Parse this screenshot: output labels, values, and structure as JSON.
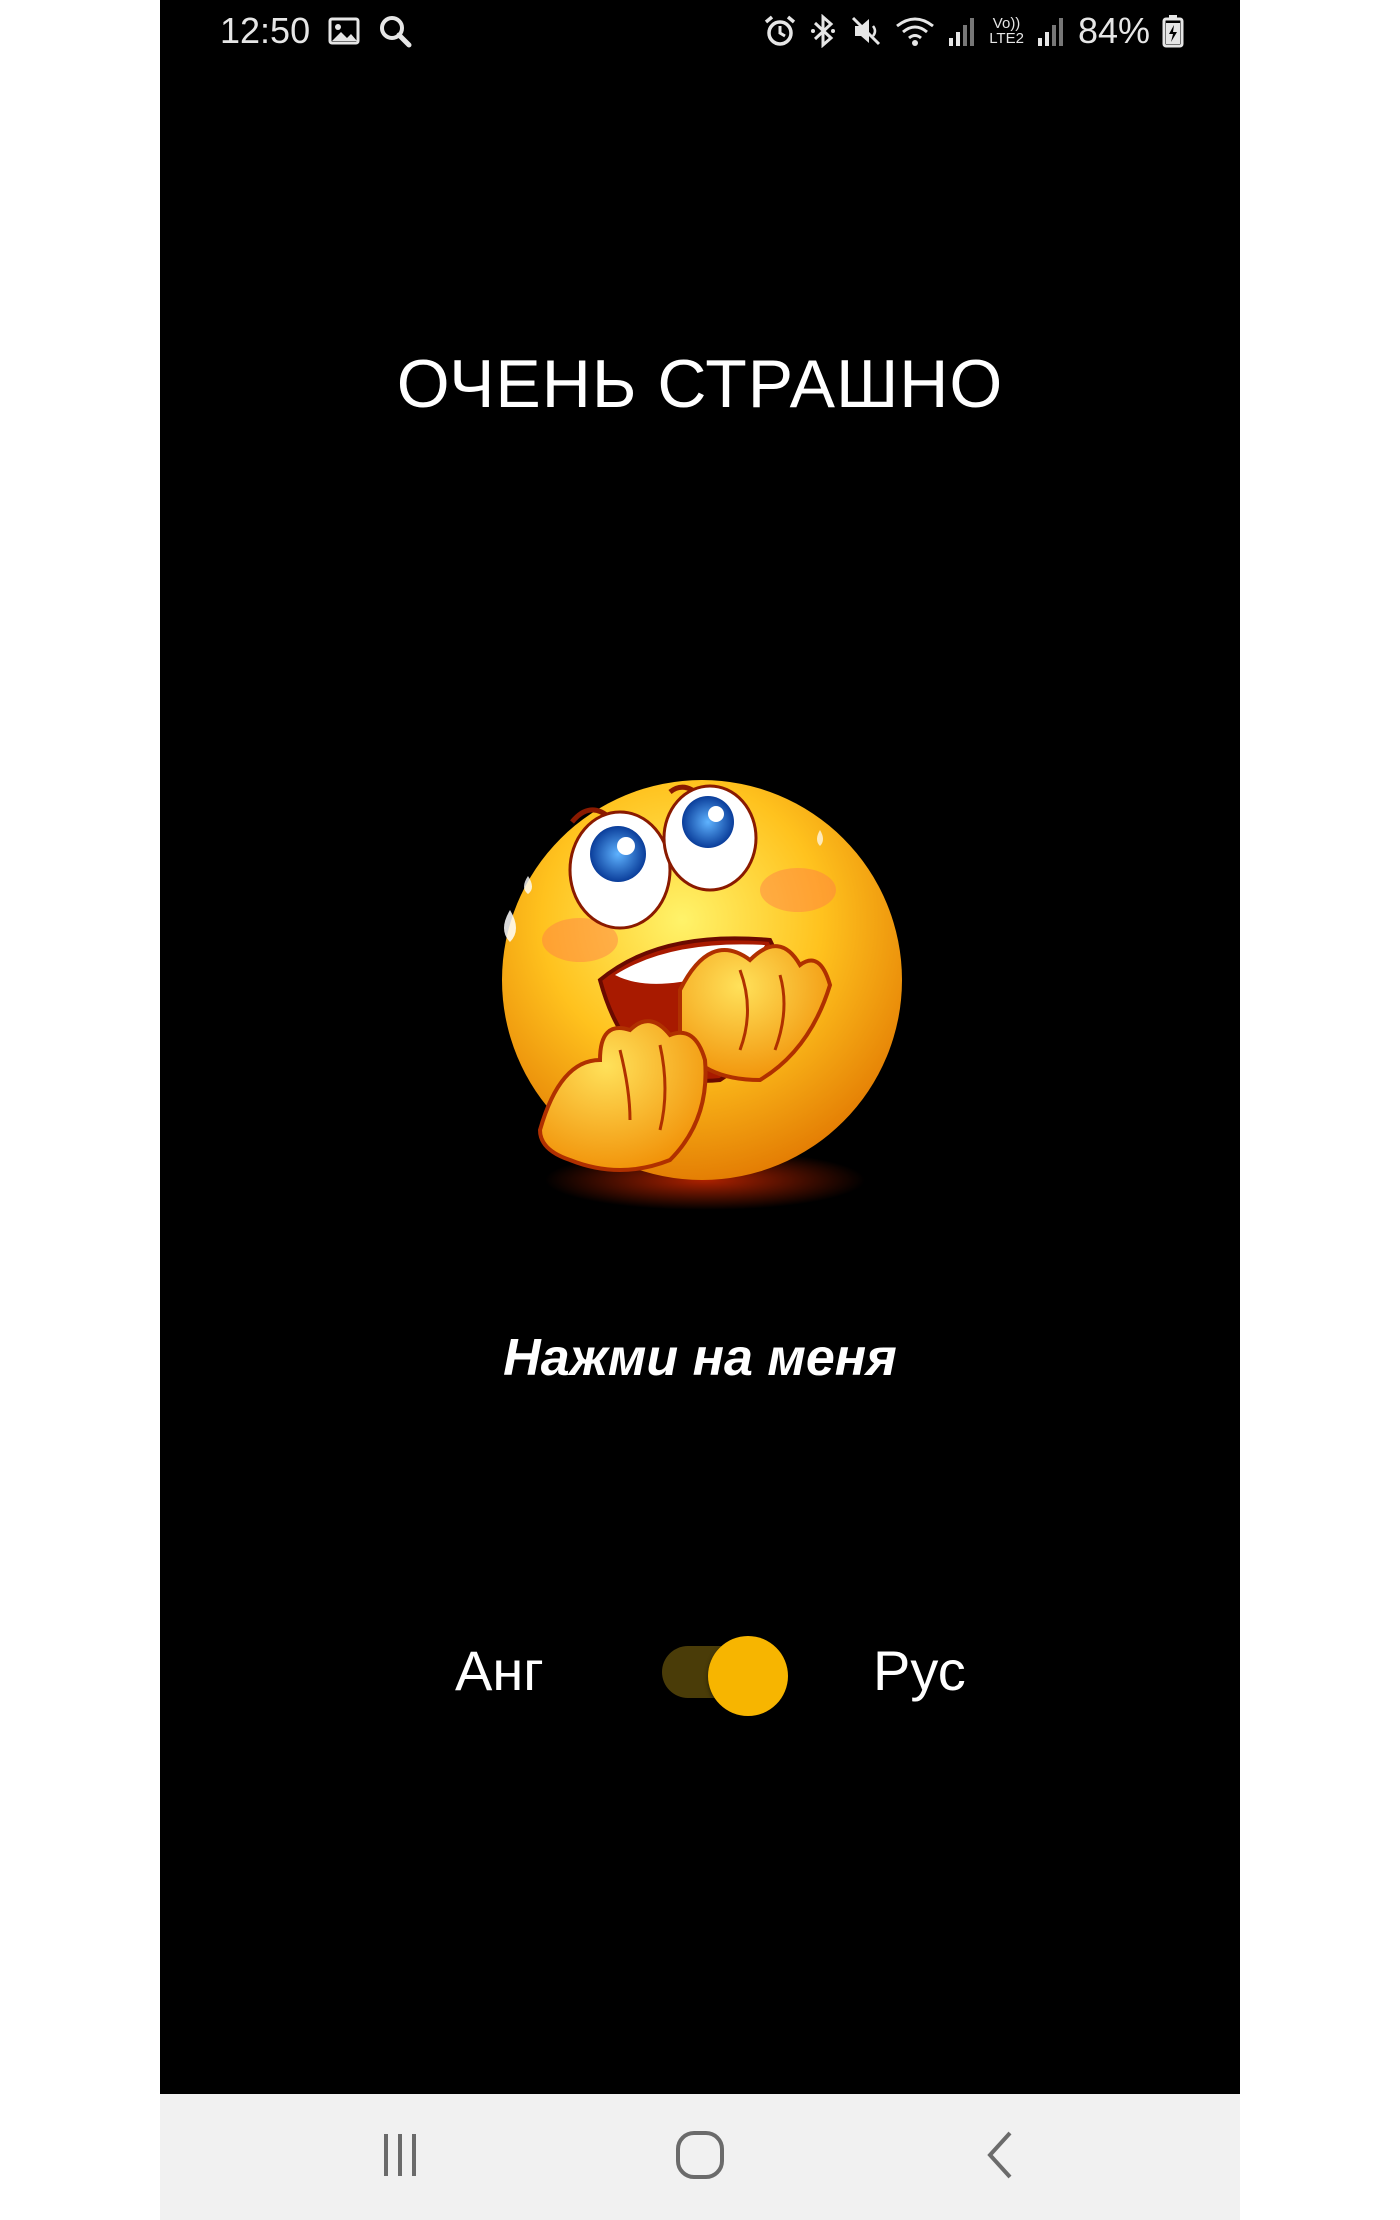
{
  "status_bar": {
    "time": "12:50",
    "battery": "84%",
    "lte_top": "Vo))",
    "lte_bottom": "LTE2",
    "icons_left": [
      "image-icon",
      "search-icon"
    ],
    "icons_right": [
      "alarm-icon",
      "bluetooth-icon",
      "mute-icon",
      "wifi-icon",
      "signal-icon",
      "signal-icon",
      "battery-icon"
    ]
  },
  "main": {
    "title": "ОЧЕНЬ СТРАШНО",
    "hint": "Нажми на меня",
    "emoji": "scared-face-emoji"
  },
  "language_toggle": {
    "left_label": "Анг",
    "right_label": "Рус",
    "is_on": true,
    "accent_color": "#f7b500",
    "track_color": "#4a3c08"
  },
  "nav_bar": {
    "items": [
      "recent-apps-icon",
      "home-icon",
      "back-icon"
    ]
  }
}
